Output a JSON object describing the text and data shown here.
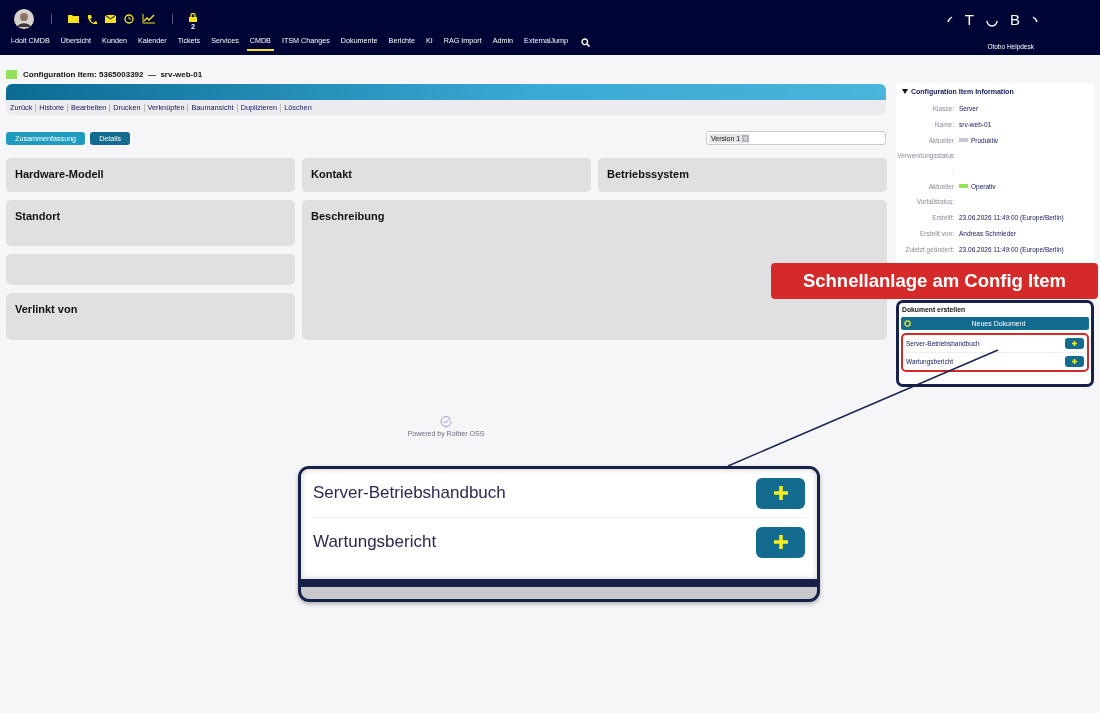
{
  "header": {
    "logo": {
      "letters": [
        "T",
        "B"
      ]
    },
    "product": "Otobo Helpdesk",
    "lock_count": "2",
    "nav": [
      {
        "label": "i-doit CMDB",
        "selected": false
      },
      {
        "label": "Übersicht",
        "selected": false
      },
      {
        "label": "Kunden",
        "selected": false
      },
      {
        "label": "Kalender",
        "selected": false
      },
      {
        "label": "Tickets",
        "selected": false
      },
      {
        "label": "Services",
        "selected": false
      },
      {
        "label": "CMDB",
        "selected": true
      },
      {
        "label": "ITSM Changes",
        "selected": false
      },
      {
        "label": "Dokumente",
        "selected": false
      },
      {
        "label": "Berichte",
        "selected": false
      },
      {
        "label": "KI",
        "selected": false
      },
      {
        "label": "RAG Import",
        "selected": false
      },
      {
        "label": "Admin",
        "selected": false
      },
      {
        "label": "ExternalJump",
        "selected": false
      }
    ]
  },
  "page": {
    "title": "Configuration Item: 5365003392  —  srv-web-01",
    "color": "#92e25a",
    "actions": [
      "Zurück",
      "Historie",
      "Bearbeiten",
      "Drucken",
      "Verknüpfen",
      "Baumansicht",
      "Duplizieren",
      "Löschen"
    ],
    "view_tabs": [
      {
        "label": "Zusammenfassung",
        "selected": true
      },
      {
        "label": "Details",
        "selected": false
      }
    ],
    "version_tag": "Version 1",
    "cards": [
      {
        "title": "Hardware-Modell",
        "kind": "small"
      },
      {
        "title": "Kontakt",
        "kind": "small"
      },
      {
        "title": "Betriebssystem",
        "kind": "small"
      },
      {
        "title": "Standort",
        "kind": "medium"
      },
      {
        "title": "Beschreibung",
        "kind": "wide"
      },
      {
        "kind": "empty"
      },
      {
        "title": "Verlinkt von",
        "kind": "medium"
      }
    ],
    "footer": "Powered by Rother OSS"
  },
  "sidebar": {
    "info_title": "Configuration Item Information",
    "info": [
      {
        "label": "Klasse:",
        "value": "Server"
      },
      {
        "label": "Name:",
        "value": "srv-web-01"
      },
      {
        "label": "Aktueller Verwendungsstatus:",
        "value": "Produktiv",
        "color": "#c8c8d0"
      },
      {
        "label": "Aktueller Vorfallstatus:",
        "value": "Operativ",
        "color": "#92e25a"
      },
      {
        "label": "Erstellt:",
        "value": "23.06.2026 11:49:00 (Europe/Berlin)"
      },
      {
        "label": "Erstellt von:",
        "value": "Andreas Schmieder"
      },
      {
        "label": "Zuletzt geändert:",
        "value": "23.06.2026 11:49:00 (Europe/Berlin)"
      }
    ],
    "documents": {
      "title": "Dokument erstellen",
      "new_button": "Neues Dokument",
      "templates": [
        "Server-Betriebshandbuch",
        "Wartungsbericht"
      ]
    }
  },
  "annotations": {
    "callout": "Schnellanlage am Config Item",
    "magnifier": {
      "rows": [
        "Server-Betriebshandbuch",
        "Wartungsbericht"
      ]
    }
  }
}
